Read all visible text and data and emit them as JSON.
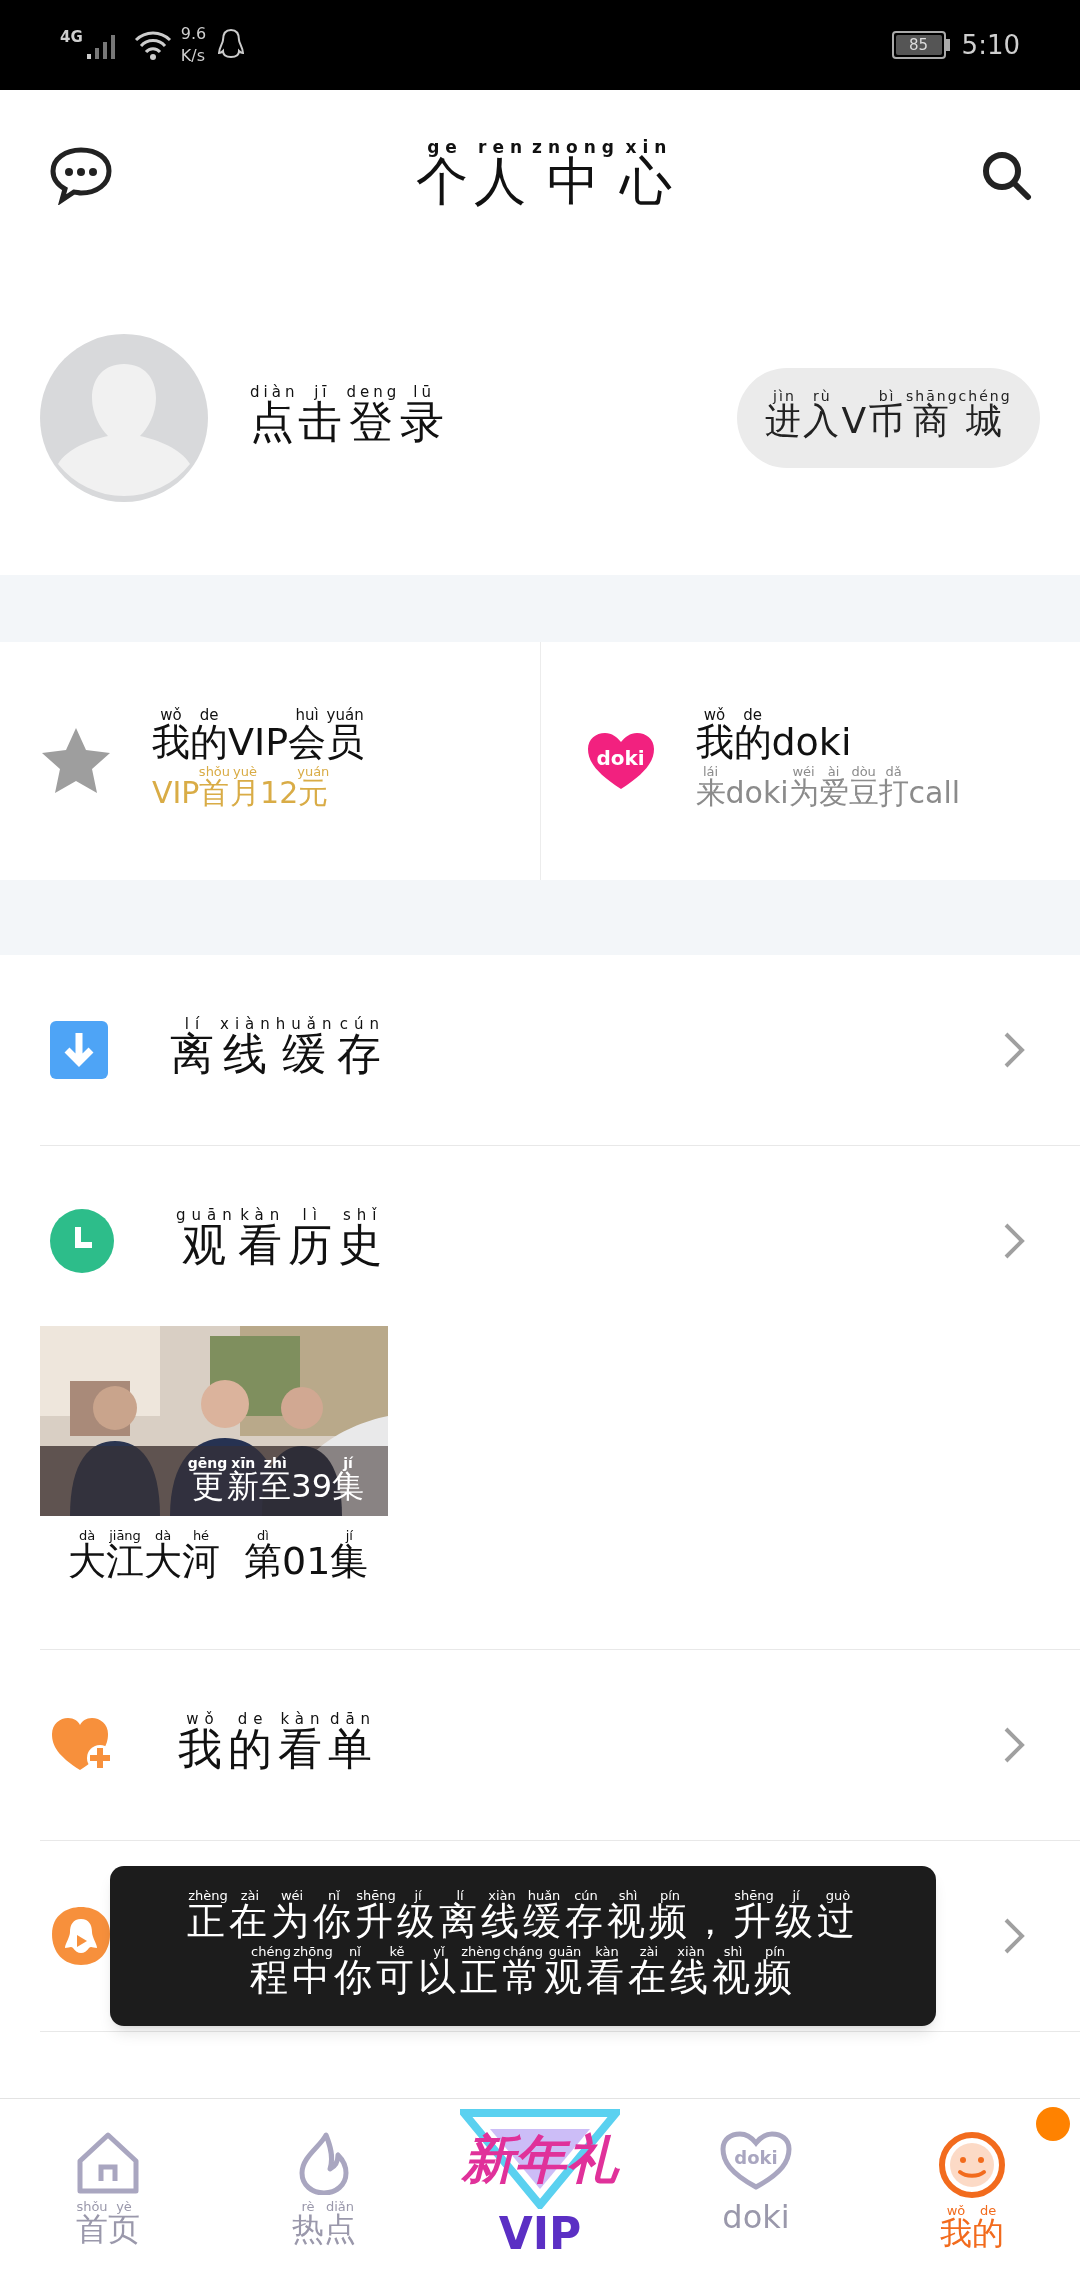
{
  "status_bar": {
    "network": "4G",
    "speed_value": "9.6",
    "speed_unit": "K/s",
    "battery": "85",
    "time": "5:10"
  },
  "header": {
    "title": [
      {
        "pinyin": "ge",
        "text": "个"
      },
      {
        "pinyin": "ren",
        "text": "人"
      },
      {
        "pinyin": "znong",
        "text": "中"
      },
      {
        "pinyin": "xin",
        "text": "心"
      }
    ]
  },
  "profile": {
    "login": [
      {
        "pinyin": "diàn",
        "text": "点"
      },
      {
        "pinyin": "jī",
        "text": "击"
      },
      {
        "pinyin": "deng",
        "text": "登"
      },
      {
        "pinyin": "lū",
        "text": "录"
      }
    ],
    "shop_button": [
      {
        "pinyin": "jìn",
        "text": "进"
      },
      {
        "pinyin": "rù",
        "text": "入"
      },
      {
        "text": "V"
      },
      {
        "pinyin": "bì",
        "text": "币"
      },
      {
        "pinyin": "shāng",
        "text": "商"
      },
      {
        "pinyin": "chéng",
        "text": "城"
      }
    ]
  },
  "cards": [
    {
      "kind": "vip",
      "title": [
        {
          "pinyin": "wǒ",
          "text": "我"
        },
        {
          "pinyin": "de",
          "text": "的"
        },
        {
          "text": "VIP"
        },
        {
          "pinyin": "huì",
          "text": "会"
        },
        {
          "pinyin": "yuán",
          "text": "员"
        }
      ],
      "subtitle": [
        {
          "text": "VIP"
        },
        {
          "pinyin": "shǒu",
          "text": "首"
        },
        {
          "pinyin": "yuè",
          "text": "月"
        },
        {
          "text": "12"
        },
        {
          "pinyin": "yuán",
          "text": "元"
        }
      ]
    },
    {
      "kind": "doki",
      "icon_text": "doki",
      "title": [
        {
          "pinyin": "wǒ",
          "text": "我"
        },
        {
          "pinyin": "de",
          "text": "的"
        },
        {
          "text": "doki"
        }
      ],
      "subtitle": [
        {
          "pinyin": "lái",
          "text": "来"
        },
        {
          "text": "doki"
        },
        {
          "pinyin": "wéi",
          "text": "为"
        },
        {
          "pinyin": "ài",
          "text": "爱"
        },
        {
          "pinyin": "dòu",
          "text": "豆"
        },
        {
          "pinyin": "dǎ",
          "text": "打"
        },
        {
          "text": "call"
        }
      ]
    }
  ],
  "menu": [
    {
      "kind": "download",
      "label": [
        {
          "pinyin": "lí",
          "text": "离"
        },
        {
          "pinyin": "xiàn",
          "text": "线"
        },
        {
          "pinyin": "huǎn",
          "text": "缓"
        },
        {
          "pinyin": "cún",
          "text": "存"
        }
      ]
    },
    {
      "kind": "history",
      "label": [
        {
          "pinyin": "guān",
          "text": "观"
        },
        {
          "pinyin": "kàn",
          "text": "看"
        },
        {
          "pinyin": "lì",
          "text": "历"
        },
        {
          "pinyin": "shǐ",
          "text": "史"
        }
      ],
      "items": [
        {
          "kind": "picture",
          "overlay": [
            {
              "pinyin": "gēng",
              "text": "更"
            },
            {
              "pinyin": "xīn",
              "text": "新"
            },
            {
              "pinyin": "zhì",
              "text": "至"
            },
            {
              "text": "39"
            },
            {
              "pinyin": "jí",
              "text": "集"
            }
          ],
          "caption": [
            [
              {
                "pinyin": "dà",
                "text": "大"
              },
              {
                "pinyin": "jiāng",
                "text": "江"
              },
              {
                "pinyin": "dà",
                "text": "大"
              },
              {
                "pinyin": "hé",
                "text": "河"
              }
            ],
            [
              {
                "pinyin": "dì",
                "text": "第"
              },
              {
                "text": "01"
              },
              {
                "pinyin": "jí",
                "text": "集"
              }
            ]
          ]
        }
      ]
    },
    {
      "kind": "watchlist",
      "label": [
        {
          "pinyin": "wǒ",
          "text": "我"
        },
        {
          "pinyin": "de",
          "text": "的"
        },
        {
          "pinyin": "kàn",
          "text": "看"
        },
        {
          "pinyin": "dān",
          "text": "单"
        }
      ]
    },
    {
      "kind": "subscribe"
    }
  ],
  "toast": {
    "lines": [
      [
        {
          "pinyin": "zhèng",
          "text": "正"
        },
        {
          "pinyin": "zài",
          "text": "在"
        },
        {
          "pinyin": "wéi",
          "text": "为"
        },
        {
          "pinyin": "nǐ",
          "text": "你"
        },
        {
          "pinyin": "shēng",
          "text": "升"
        },
        {
          "pinyin": "jí",
          "text": "级"
        },
        {
          "pinyin": "lí",
          "text": "离"
        },
        {
          "pinyin": "xiàn",
          "text": "线"
        },
        {
          "pinyin": "huǎn",
          "text": "缓"
        },
        {
          "pinyin": "cún",
          "text": "存"
        },
        {
          "pinyin": "shì",
          "text": "视"
        },
        {
          "pinyin": "pín",
          "text": "频"
        },
        {
          "text": "，"
        },
        {
          "pinyin": "shēng",
          "text": "升"
        },
        {
          "pinyin": "jí",
          "text": "级"
        },
        {
          "pinyin": "guò",
          "text": "过"
        }
      ],
      [
        {
          "pinyin": "chéng",
          "text": "程"
        },
        {
          "pinyin": "zhōng",
          "text": "中"
        },
        {
          "pinyin": "nǐ",
          "text": "你"
        },
        {
          "pinyin": "kě",
          "text": "可"
        },
        {
          "pinyin": "yǐ",
          "text": "以"
        },
        {
          "pinyin": "zhèng",
          "text": "正"
        },
        {
          "pinyin": "cháng",
          "text": "常"
        },
        {
          "pinyin": "guān",
          "text": "观"
        },
        {
          "pinyin": "kàn",
          "text": "看"
        },
        {
          "pinyin": "zài",
          "text": "在"
        },
        {
          "pinyin": "xiàn",
          "text": "线"
        },
        {
          "pinyin": "shì",
          "text": "视"
        },
        {
          "pinyin": "pín",
          "text": "频"
        }
      ]
    ]
  },
  "tabs": [
    {
      "kind": "home",
      "label": [
        {
          "pinyin": "shǒu",
          "text": "首"
        },
        {
          "pinyin": "yè",
          "text": "页"
        }
      ],
      "selected": false,
      "dot": false
    },
    {
      "kind": "hot",
      "label": [
        {
          "pinyin": "rè",
          "text": "热"
        },
        {
          "pinyin": "diǎn",
          "text": "点"
        }
      ],
      "selected": false,
      "dot": false
    },
    {
      "kind": "vip",
      "promo": "新年礼",
      "label": [
        {
          "text": "VIP"
        }
      ],
      "selected": false,
      "dot": false
    },
    {
      "kind": "doki",
      "icon_text": "doki",
      "label": [
        {
          "text": "doki"
        }
      ],
      "selected": false,
      "dot": false
    },
    {
      "kind": "me",
      "label": [
        {
          "pinyin": "wǒ",
          "text": "我"
        },
        {
          "pinyin": "de",
          "text": "的"
        }
      ],
      "selected": true,
      "dot": true
    }
  ]
}
